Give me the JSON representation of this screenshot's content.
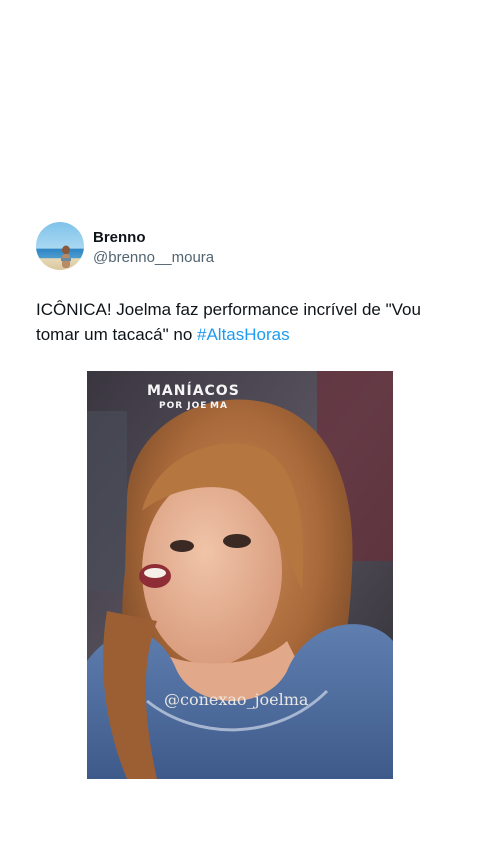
{
  "author": {
    "display_name": "Brenno",
    "handle": "@brenno__moura"
  },
  "tweet": {
    "text_before": "ICÔNICA! Joelma faz performance incrível de \"Vou tomar um tacacá\" no ",
    "hashtag": "#AltasHoras"
  },
  "media": {
    "watermark_top_line1": "MANÍACOS",
    "watermark_top_line2": "POR JOE",
    "watermark_top_line3": "MA",
    "watermark_bottom": "@conexao_joelma"
  },
  "colors": {
    "hashtag": "#1d9bf0",
    "handle": "#536471",
    "text": "#0f1419"
  }
}
